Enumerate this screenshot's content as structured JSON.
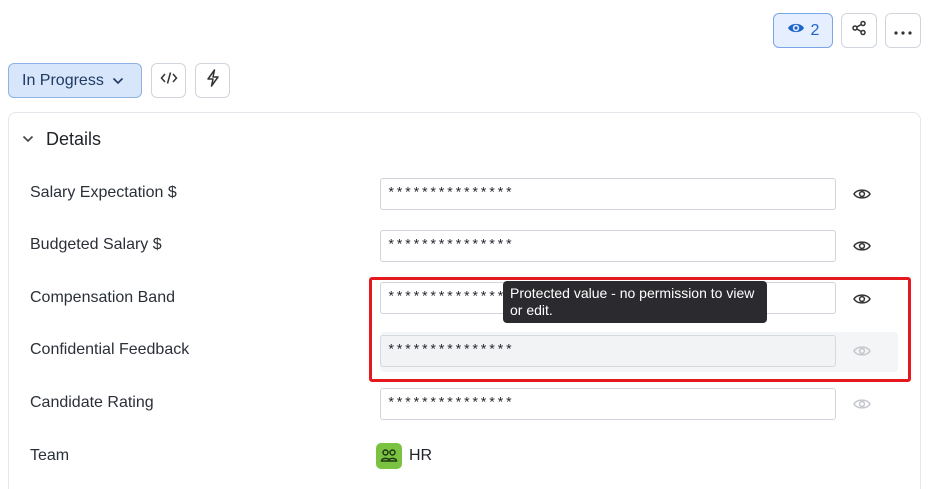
{
  "toolbar": {
    "watch_count": "2",
    "status_label": "In Progress"
  },
  "section": {
    "title": "Details"
  },
  "fields": [
    {
      "label": "Salary Expectation $",
      "value": "***************"
    },
    {
      "label": "Budgeted Salary $",
      "value": "***************"
    },
    {
      "label": "Compensation Band",
      "value": "***************"
    },
    {
      "label": "Confidential Feedback",
      "value": "***************"
    },
    {
      "label": "Candidate Rating",
      "value": "***************"
    },
    {
      "label": "Team",
      "value": "HR"
    }
  ],
  "tooltip": {
    "text": "Protected value - no permission to view or edit."
  },
  "colors": {
    "status_bg": "#d8e6fb",
    "watch_accent": "#1e63c9",
    "highlight_border": "#e3191e",
    "team_icon": "#7cc242"
  },
  "icons": [
    "eye-icon",
    "share-icon",
    "more-icon",
    "chevron-down-icon",
    "code-icon",
    "bolt-icon",
    "team-icon"
  ]
}
